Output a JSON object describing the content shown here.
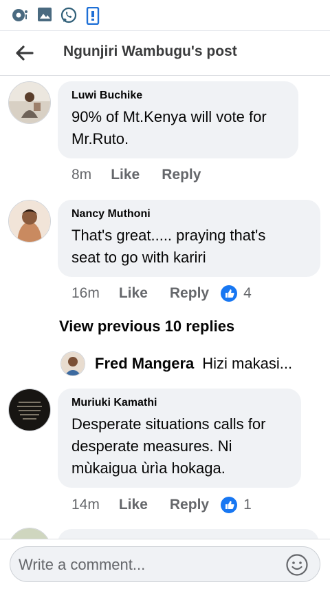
{
  "header": {
    "title": "Ngunjiri Wambugu's post"
  },
  "comments": [
    {
      "name": "Luwi Buchike",
      "text_lines": [
        "90% of Mt.Kenya will vote for",
        "Mr.Ruto."
      ],
      "time": "8m",
      "like_label": "Like",
      "reply_label": "Reply"
    },
    {
      "name": "Nancy Muthoni",
      "text_lines": [
        "That's great..... praying that's",
        "seat to go with kariri"
      ],
      "time": "16m",
      "like_label": "Like",
      "reply_label": "Reply",
      "reactions": "4"
    },
    {
      "name": "Muriuki Kamathi",
      "text_lines": [
        "Desperate situations calls for",
        "desperate measures. Ni",
        "mùkaigua ùrìa hokaga."
      ],
      "time": "14m",
      "like_label": "Like",
      "reply_label": "Reply",
      "reactions": "1"
    }
  ],
  "view_previous": "View previous 10 replies",
  "reply_preview": {
    "name": "Fred Mangera",
    "text": "Hizi makasi..."
  },
  "composer": {
    "placeholder": "Write a comment..."
  },
  "colors": {
    "like_blue": "#1877f2",
    "bubble_bg": "#f0f2f5",
    "whatsapp_green": "#25d366"
  }
}
